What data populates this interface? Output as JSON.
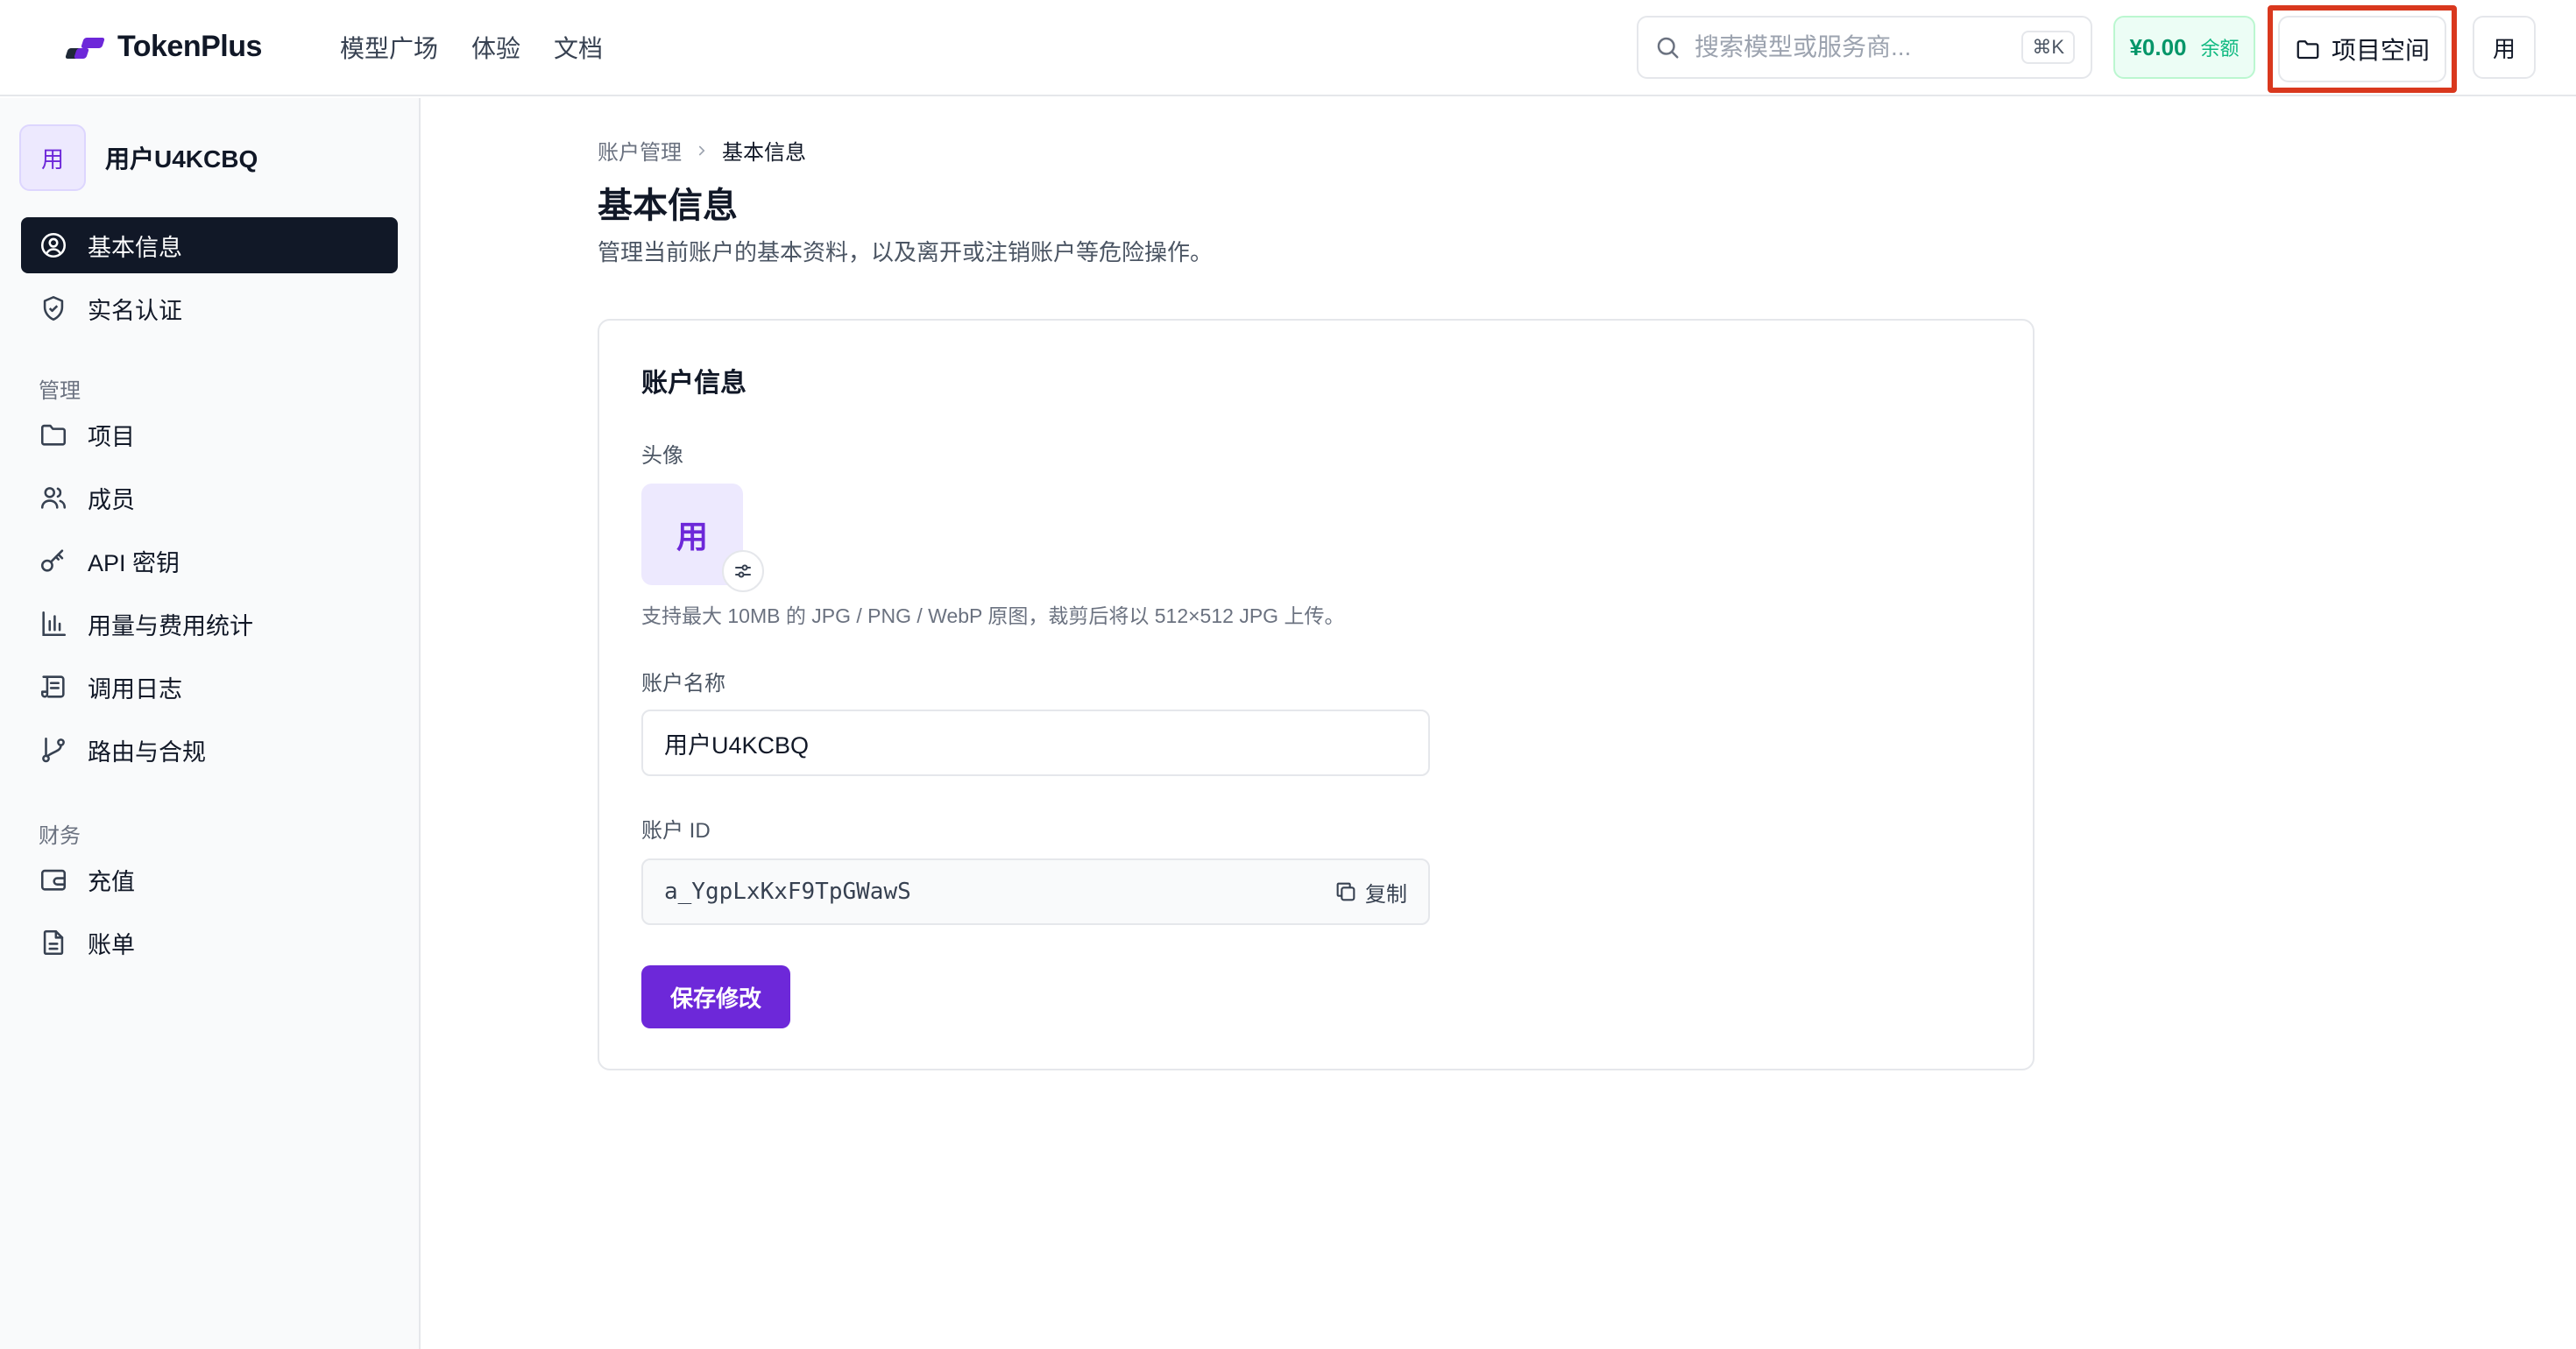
{
  "brand": {
    "name": "TokenPlus"
  },
  "topnav": {
    "items": [
      "模型广场",
      "体验",
      "文档"
    ]
  },
  "search": {
    "placeholder": "搜索模型或服务商...",
    "shortcut": "⌘K"
  },
  "balance": {
    "amount": "¥0.00",
    "label": "余额"
  },
  "project_space": {
    "label": "项目空间"
  },
  "user_menu": {
    "initial": "用"
  },
  "sidebar": {
    "user": {
      "avatar": "用",
      "name": "用户U4KCBQ"
    },
    "account_items": [
      {
        "label": "基本信息",
        "icon": "user-circle-icon",
        "active": true
      },
      {
        "label": "实名认证",
        "icon": "shield-check-icon",
        "active": false
      }
    ],
    "manage_title": "管理",
    "manage_items": [
      {
        "label": "项目",
        "icon": "folder-icon"
      },
      {
        "label": "成员",
        "icon": "users-icon"
      },
      {
        "label": "API 密钥",
        "icon": "key-icon"
      },
      {
        "label": "用量与费用统计",
        "icon": "bar-chart-icon"
      },
      {
        "label": "调用日志",
        "icon": "scroll-log-icon"
      },
      {
        "label": "路由与合规",
        "icon": "git-branch-icon"
      }
    ],
    "finance_title": "财务",
    "finance_items": [
      {
        "label": "充值",
        "icon": "wallet-icon"
      },
      {
        "label": "账单",
        "icon": "file-text-icon"
      }
    ]
  },
  "breadcrumb": {
    "parent": "账户管理",
    "current": "基本信息"
  },
  "page": {
    "title": "基本信息",
    "subtitle": "管理当前账户的基本资料，以及离开或注销账户等危险操作。"
  },
  "account_card": {
    "title": "账户信息",
    "avatar_label": "头像",
    "avatar_initial": "用",
    "avatar_hint": "支持最大 10MB 的 JPG / PNG / WebP 原图，裁剪后将以 512×512 JPG 上传。",
    "name_label": "账户名称",
    "name_value": "用户U4KCBQ",
    "id_label": "账户 ID",
    "id_value": "a_YgpLxKxF9TpGWawS",
    "copy_label": "复制",
    "save_label": "保存修改"
  },
  "colors": {
    "accent": "#6d28d9",
    "highlight": "#d9381e",
    "balance": "#059669",
    "active_nav": "#111827"
  }
}
